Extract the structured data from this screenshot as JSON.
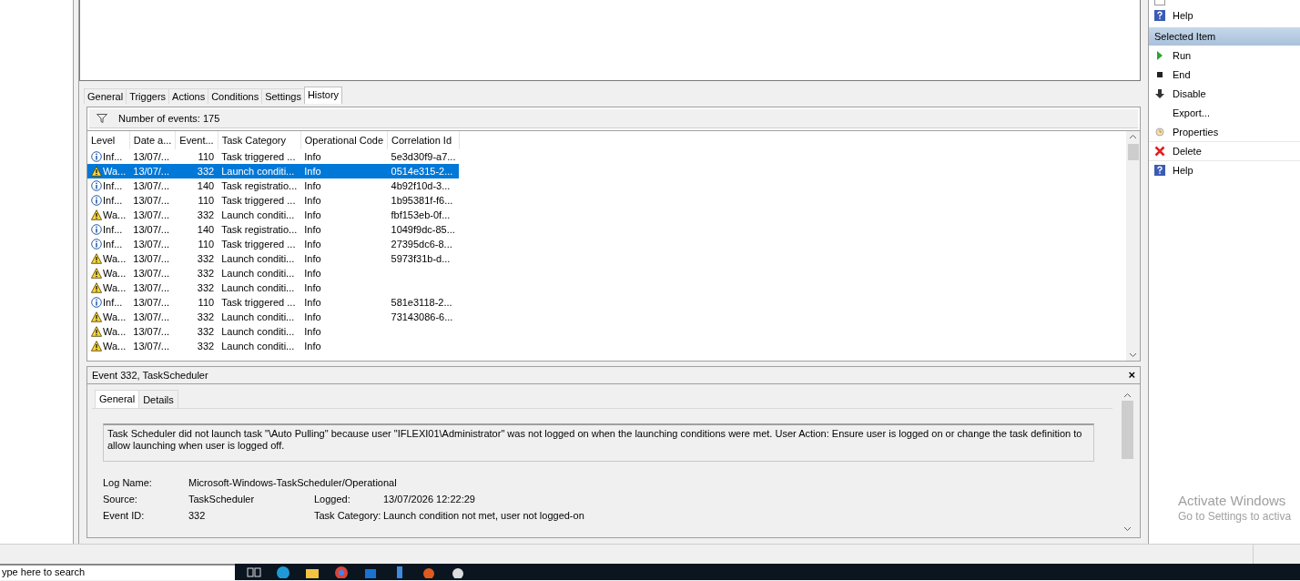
{
  "tabs": [
    {
      "label": "General",
      "selected": false
    },
    {
      "label": "Triggers",
      "selected": false
    },
    {
      "label": "Actions",
      "selected": false
    },
    {
      "label": "Conditions",
      "selected": false
    },
    {
      "label": "Settings",
      "selected": false
    },
    {
      "label": "History",
      "selected": true
    }
  ],
  "history": {
    "event_count": "Number of events: 175",
    "columns": [
      "Level",
      "Date a...",
      "Event...",
      "Task Category",
      "Operational Code",
      "Correlation Id"
    ],
    "rows": [
      {
        "kind": "info",
        "level": "Inf...",
        "date": "13/07/...",
        "event": "110",
        "category": "Task triggered ...",
        "opcode": "Info",
        "correlation": "5e3d30f9-a7...",
        "selected": false
      },
      {
        "kind": "warning",
        "level": "Wa...",
        "date": "13/07/...",
        "event": "332",
        "category": "Launch conditi...",
        "opcode": "Info",
        "correlation": "0514e315-2...",
        "selected": true
      },
      {
        "kind": "info",
        "level": "Inf...",
        "date": "13/07/...",
        "event": "140",
        "category": "Task registratio...",
        "opcode": "Info",
        "correlation": "4b92f10d-3...",
        "selected": false
      },
      {
        "kind": "info",
        "level": "Inf...",
        "date": "13/07/...",
        "event": "110",
        "category": "Task triggered ...",
        "opcode": "Info",
        "correlation": "1b95381f-f6...",
        "selected": false
      },
      {
        "kind": "warning",
        "level": "Wa...",
        "date": "13/07/...",
        "event": "332",
        "category": "Launch conditi...",
        "opcode": "Info",
        "correlation": "fbf153eb-0f...",
        "selected": false
      },
      {
        "kind": "info",
        "level": "Inf...",
        "date": "13/07/...",
        "event": "140",
        "category": "Task registratio...",
        "opcode": "Info",
        "correlation": "1049f9dc-85...",
        "selected": false
      },
      {
        "kind": "info",
        "level": "Inf...",
        "date": "13/07/...",
        "event": "110",
        "category": "Task triggered ...",
        "opcode": "Info",
        "correlation": "27395dc6-8...",
        "selected": false
      },
      {
        "kind": "warning",
        "level": "Wa...",
        "date": "13/07/...",
        "event": "332",
        "category": "Launch conditi...",
        "opcode": "Info",
        "correlation": "5973f31b-d...",
        "selected": false
      },
      {
        "kind": "warning",
        "level": "Wa...",
        "date": "13/07/...",
        "event": "332",
        "category": "Launch conditi...",
        "opcode": "Info",
        "selected": false
      },
      {
        "kind": "warning",
        "level": "Wa...",
        "date": "13/07/...",
        "event": "332",
        "category": "Launch conditi...",
        "opcode": "Info",
        "selected": false
      },
      {
        "kind": "info",
        "level": "Inf...",
        "date": "13/07/...",
        "event": "110",
        "category": "Task triggered ...",
        "opcode": "Info",
        "correlation": "581e3118-2...",
        "selected": false
      },
      {
        "kind": "warning",
        "level": "Wa...",
        "date": "13/07/...",
        "event": "332",
        "category": "Launch conditi...",
        "opcode": "Info",
        "correlation": "73143086-6...",
        "selected": false
      },
      {
        "kind": "warning",
        "level": "Wa...",
        "date": "13/07/...",
        "event": "332",
        "category": "Launch conditi...",
        "opcode": "Info",
        "selected": false
      },
      {
        "kind": "warning",
        "level": "Wa...",
        "date": "13/07/...",
        "event": "332",
        "category": "Launch conditi...",
        "opcode": "Info",
        "selected": false
      }
    ]
  },
  "event_details": {
    "title": "Event 332, TaskScheduler",
    "close": "×",
    "tabs": [
      {
        "label": "General",
        "selected": true
      },
      {
        "label": "Details",
        "selected": false
      }
    ],
    "message": "Task Scheduler did not launch task \"\\Auto Pulling\"  because user \"IFLEXI01\\Administrator\" was not logged on when the launching conditions were met. User Action: Ensure user is logged on or change the task definition to allow launching when user is logged off.",
    "fields": [
      [
        {
          "label": "Log Name:",
          "value": "Microsoft-Windows-TaskScheduler/Operational"
        }
      ],
      [
        {
          "label": "Source:",
          "value": "TaskScheduler"
        },
        {
          "label": "Logged:",
          "value": "13/07/2026 12:22:29"
        }
      ],
      [
        {
          "label": "Event ID:",
          "value": "332"
        },
        {
          "label": "Task Category:",
          "value": "Launch condition not met, user not logged-on"
        }
      ]
    ]
  },
  "actions": {
    "top_items": [
      {
        "kind": "help",
        "label": "Help"
      }
    ],
    "section_title": "Selected Item",
    "items": [
      {
        "kind": "run",
        "label": "Run"
      },
      {
        "kind": "end",
        "label": "End"
      },
      {
        "kind": "disable",
        "label": "Disable"
      },
      {
        "kind": "none",
        "label": "Export..."
      },
      {
        "kind": "properties",
        "label": "Properties"
      },
      {
        "kind": "delete",
        "label": "Delete"
      },
      {
        "kind": "help",
        "label": "Help"
      }
    ]
  },
  "activation_notice": {
    "title": "Activate Windows",
    "subtitle": "Go to Settings to activa"
  },
  "taskbar": {
    "search_placeholder": "ype here to search"
  }
}
